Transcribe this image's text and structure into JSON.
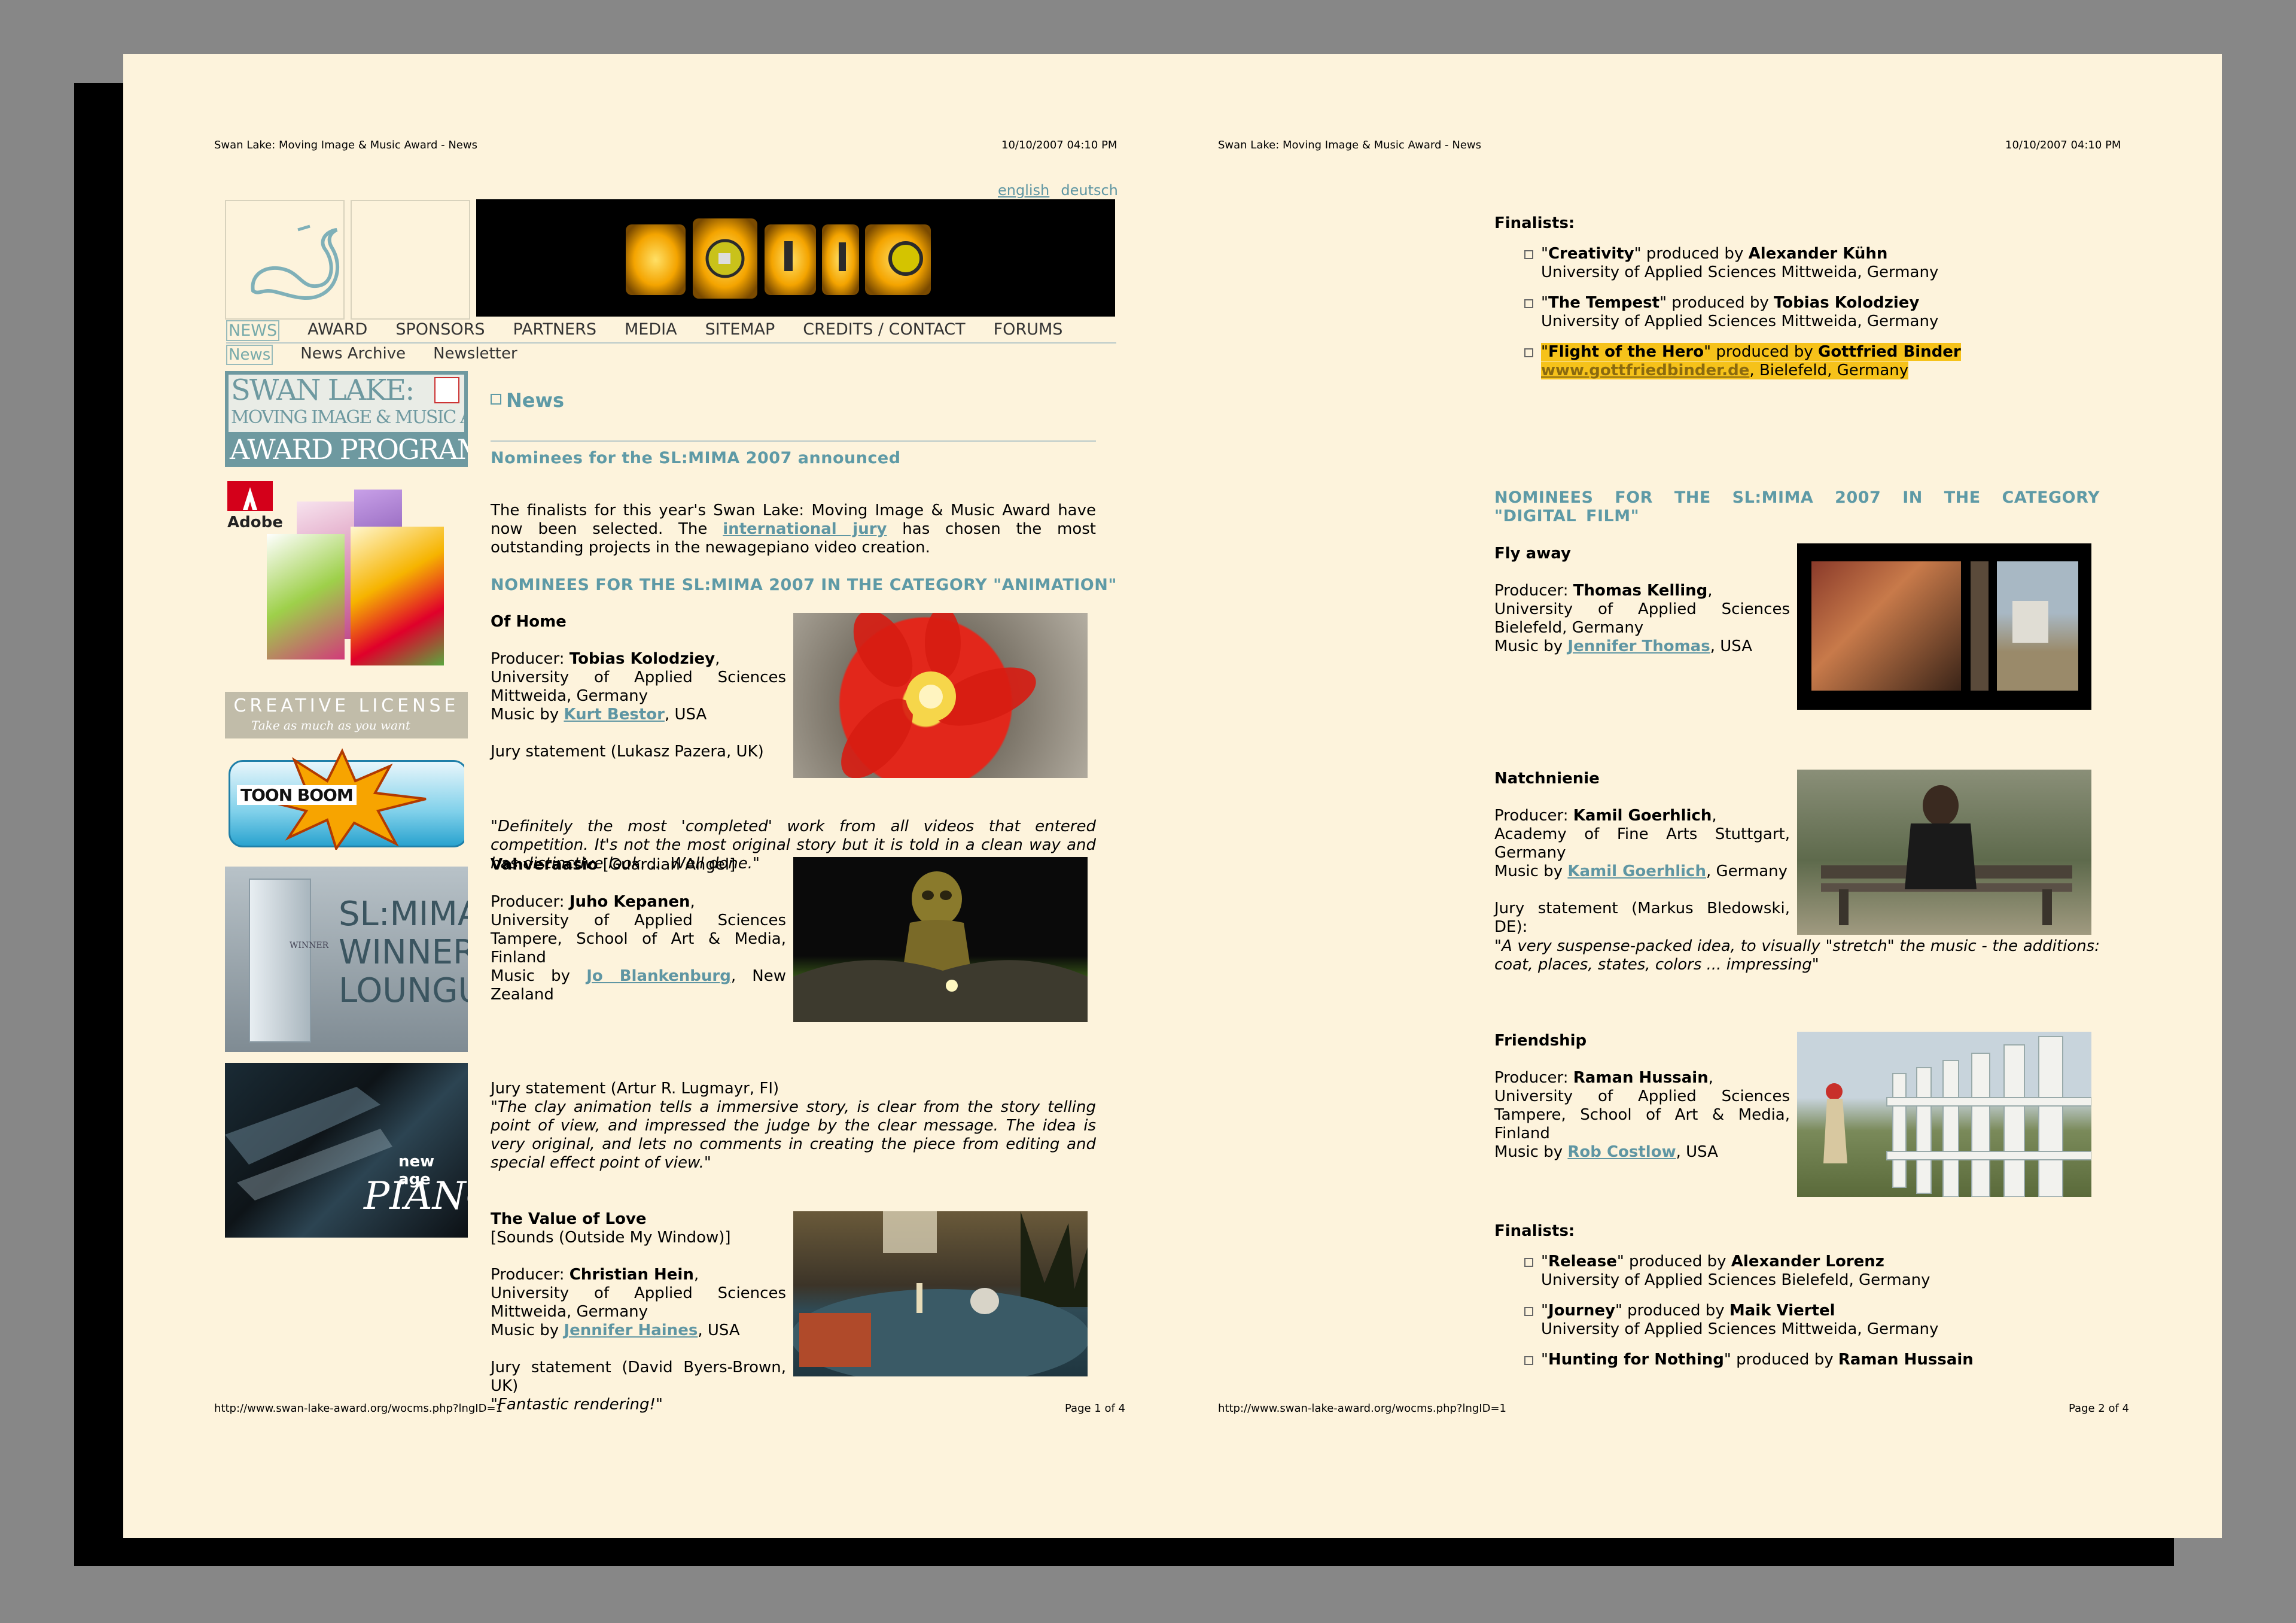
{
  "header": {
    "title": "Swan Lake: Moving Image & Music Award - News",
    "datetime": "10/10/2007 04:10 PM"
  },
  "footer": {
    "url": "http://www.swan-lake-award.org/wocms.php?lngID=1",
    "page1": "Page 1 of 4",
    "page2": "Page 2 of 4"
  },
  "lang": {
    "english": "english",
    "deutsch": "deutsch"
  },
  "nav": {
    "items": [
      "NEWS",
      "AWARD",
      "SPONSORS",
      "PARTNERS",
      "MEDIA",
      "SITEMAP",
      "CREDITS / CONTACT",
      "FORUMS"
    ],
    "sub": [
      "News",
      "News Archive",
      "Newsletter"
    ]
  },
  "sidebar": {
    "award_programme": {
      "line1": "SWAN LAKE:",
      "line2": "MOVING IMAGE & MUSIC AWARD",
      "line3": "AWARD PROGRAMME"
    },
    "adobe": {
      "brand": "Adobe"
    },
    "creative_license": {
      "title": "CREATIVE LICENSE",
      "tagline": "Take as much as you want"
    },
    "toonboom": {
      "text": "TOON BOOM"
    },
    "winners": {
      "l1": "SL:MIMA",
      "l2": "WINNERS",
      "l3": "LOUNGUE",
      "winner": "WINNER"
    },
    "piano": {
      "l1": "new age",
      "l2": "PIANO"
    }
  },
  "page1": {
    "section_title": "News",
    "headline": "Nominees for the SL:MIMA 2007 announced",
    "intro_before": "The finalists for this year's Swan Lake: Moving Image & Music Award have now been selected. The ",
    "intro_link": "international jury",
    "intro_after": " has chosen the most outstanding projects in the newagepiano video creation.",
    "category": "NOMINEES FOR THE SL:MIMA 2007 IN THE CATEGORY \"ANIMATION\"",
    "entries": [
      {
        "title": "Of Home",
        "producer_label": "Producer: ",
        "producer": "Tobias Kolodziey",
        "institution": "University of Applied Sciences Mittweida, Germany",
        "music_label": "Music by ",
        "music": "Kurt Bestor",
        "music_country": ", USA",
        "jury": "Jury statement (Lukasz Pazera, UK)",
        "quote": "\"Definitely the most 'completed' work from all videos that entered competition. It's not the most original story but it is told in a clean way and has distinctive look. ... Well done.\""
      },
      {
        "title": "Vahveraasio",
        "subtitle": " [Guardian Angel]",
        "producer_label": "Producer: ",
        "producer": "Juho Kepanen",
        "institution": "University of Applied Sciences Tampere, School of Art & Media, Finland",
        "music_label": "Music by ",
        "music": "Jo Blankenburg",
        "music_country": ", New Zealand",
        "jury": "Jury statement (Artur R. Lugmayr, FI)",
        "quote": "\"The clay animation tells a immersive story, is clear from the story telling point of view, and impressed the judge by the clear message. The idea is very original, and lets no comments in creating the piece from editing and special effect point of view.\""
      },
      {
        "title": "The Value of Love",
        "subtitle": "[Sounds (Outside My Window)]",
        "producer_label": "Producer: ",
        "producer": "Christian Hein",
        "institution": "University of Applied Sciences Mittweida, Germany",
        "music_label": "Music by ",
        "music": "Jennifer Haines",
        "music_country": ", USA",
        "jury": "Jury statement (David Byers-Brown, UK)",
        "quote": "\"Fantastic rendering!\""
      }
    ]
  },
  "page2": {
    "finalists_label": "Finalists:",
    "finalists_a": [
      {
        "q1": "\"",
        "title": "Creativity",
        "q2": "\" produced by ",
        "by": "Alexander Kühn",
        "line2": "University of Applied Sciences Mittweida, Germany"
      },
      {
        "q1": "\"",
        "title": "The Tempest",
        "q2": "\" produced by ",
        "by": "Tobias Kolodziey",
        "line2": "University of Applied Sciences Mittweida, Germany"
      },
      {
        "q1": "\"",
        "title": "Flight of the Hero",
        "q2": "\" produced by ",
        "by": "Gottfried Binder",
        "link": "www.gottfriedbinder.de",
        "line2": ", Bielefeld, Germany"
      }
    ],
    "category": "NOMINEES FOR THE SL:MIMA 2007 IN THE CATEGORY \"DIGITAL FILM\"",
    "entries": [
      {
        "title": "Fly away",
        "producer_label": "Producer: ",
        "producer": "Thomas Kelling",
        "institution": "University of Applied Sciences Bielefeld, Germany",
        "music_label": "Music by ",
        "music": "Jennifer Thomas",
        "music_country": ", USA"
      },
      {
        "title": "Natchnienie",
        "producer_label": "Producer: ",
        "producer": "Kamil Goerhlich",
        "institution": "Academy of Fine Arts Stuttgart, Germany",
        "music_label": "Music by ",
        "music": "Kamil Goerhlich",
        "music_country": ", Germany",
        "jury": "Jury statement (Markus Bledowski, DE):",
        "quote": "\"A very suspense-packed idea, to visually \"stretch\" the music - the additions: coat, places, states, colors ... impressing\""
      },
      {
        "title": "Friendship",
        "producer_label": "Producer: ",
        "producer": "Raman Hussain",
        "institution": "University of Applied Sciences Tampere, School of Art & Media, Finland",
        "music_label": "Music by ",
        "music": "Rob Costlow",
        "music_country": ", USA"
      }
    ],
    "finalists_b": [
      {
        "q1": "\"",
        "title": "Release",
        "q2": "\" produced by ",
        "by": "Alexander Lorenz",
        "line2": "University of Applied Sciences Bielefeld, Germany"
      },
      {
        "q1": "\"",
        "title": "Journey",
        "q2": "\" produced by ",
        "by": "Maik Viertel",
        "line2": "University of Applied Sciences Mittweida, Germany"
      },
      {
        "q1": "\"",
        "title": "Hunting for Nothing",
        "q2": "\" produced by ",
        "by": "Raman Hussain"
      }
    ]
  },
  "colors": {
    "paper": "#fdf3dc",
    "accent_teal": "#5e9aa6",
    "highlight": "#f6c21a",
    "backdrop": "#878787"
  }
}
